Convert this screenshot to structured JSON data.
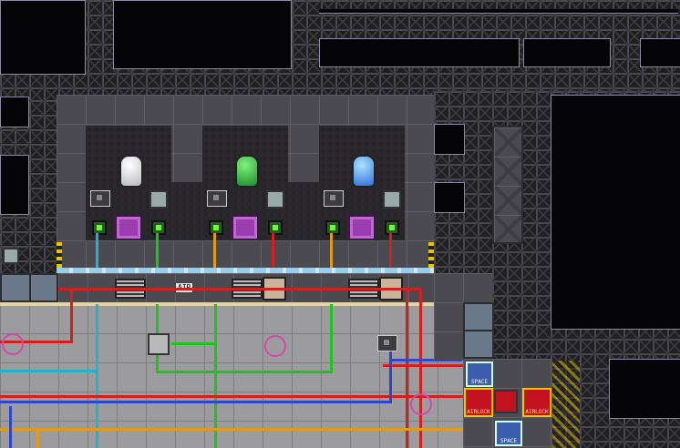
{
  "scene": {
    "description_free": true,
    "colors": {
      "waste_pipe": "#d02020",
      "supply_pipe": "#2f46c8",
      "green_pipe": "#1fc21f",
      "cyan_pipe": "#21b4c6",
      "orange_pipe": "#e09a20",
      "filter": "#9b3cb0",
      "airlock": "#c3121f"
    }
  },
  "signs": {
    "air": "AIR",
    "space_top": "SPACE",
    "space_bottom": "SPACE",
    "airlock_left": "AIRLOCK",
    "airlock_right": "AIRLOCK"
  },
  "icons": {
    "canister_nitrogen": "canister-white-icon",
    "canister_oxygen": "canister-green-icon",
    "canister_co2": "canister-blue-icon",
    "filter": "gas-filter-icon",
    "valve": "valve-icon",
    "vent": "vent-circle-icon",
    "pump": "pump-icon"
  }
}
